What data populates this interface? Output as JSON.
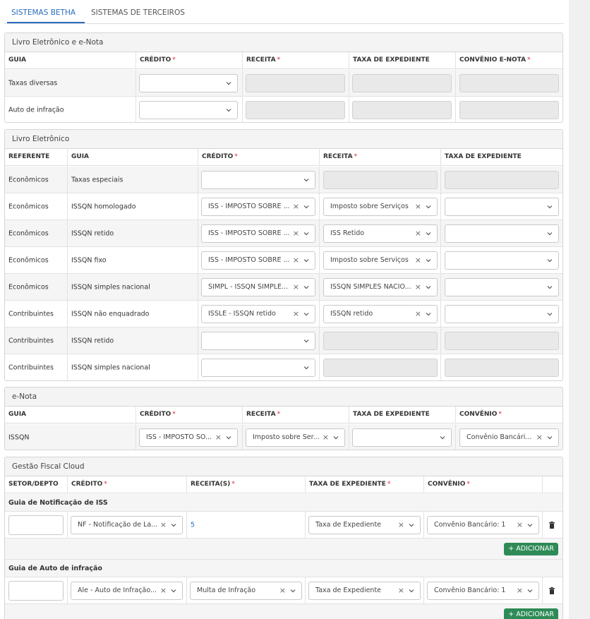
{
  "tabs": [
    {
      "label": "SISTEMAS BETHA",
      "active": true
    },
    {
      "label": "SISTEMAS DE TERCEIROS",
      "active": false
    }
  ],
  "colors": {
    "accent": "#2a6bbf",
    "required": "#dd2233",
    "add_button": "#2e8b57"
  },
  "icons": {
    "select": "chevron-down-icon",
    "clear": "close-icon",
    "delete": "trash-icon",
    "add": "plus-icon"
  },
  "required_mark": "*",
  "section1": {
    "title": "Livro Eletrônico e e-Nota",
    "headers": [
      "GUIA",
      "CRÉDITO",
      "RECEITA",
      "TAXA DE EXPEDIENTE",
      "CONVÊNIO E-NOTA"
    ],
    "rows": [
      {
        "guia": "Taxas diversas"
      },
      {
        "guia": "Auto de infração"
      }
    ]
  },
  "section2": {
    "title": "Livro Eletrônico",
    "headers": [
      "REFERENTE",
      "GUIA",
      "CRÉDITO",
      "RECEITA",
      "TAXA DE EXPEDIENTE"
    ],
    "rows": [
      {
        "referente": "Econômicos",
        "guia": "Taxas especiais",
        "credito": "",
        "receita": ""
      },
      {
        "referente": "Econômicos",
        "guia": "ISSQN homologado",
        "credito": "ISS - IMPOSTO SOBRE ...",
        "receita": "Imposto sobre Serviços"
      },
      {
        "referente": "Econômicos",
        "guia": "ISSQN retido",
        "credito": "ISS - IMPOSTO SOBRE ...",
        "receita": "ISS Retido"
      },
      {
        "referente": "Econômicos",
        "guia": "ISSQN fixo",
        "credito": "ISS - IMPOSTO SOBRE ...",
        "receita": "Imposto sobre Serviços"
      },
      {
        "referente": "Econômicos",
        "guia": "ISSQN simples nacional",
        "credito": "SIMPL - ISSQN SIMPLE...",
        "receita": "ISSQN SIMPLES NACIO..."
      },
      {
        "referente": "Contribuintes",
        "guia": "ISSQN não enquadrado",
        "credito": "ISSLE - ISSQN retido",
        "receita": "ISSQN retido"
      },
      {
        "referente": "Contribuintes",
        "guia": "ISSQN retido",
        "credito": "",
        "receita": ""
      },
      {
        "referente": "Contribuintes",
        "guia": "ISSQN simples nacional",
        "credito": "",
        "receita": ""
      }
    ]
  },
  "section3": {
    "title": "e-Nota",
    "headers": [
      "GUIA",
      "CRÉDITO",
      "RECEITA",
      "TAXA DE EXPEDIENTE",
      "CONVÊNIO"
    ],
    "row": {
      "guia": "ISSQN",
      "credito": "ISS - IMPOSTO SO...",
      "receita": "Imposto sobre Ser...",
      "convenio": "Convênio Bancári..."
    }
  },
  "section4": {
    "title": "Gestão Fiscal Cloud",
    "headers": [
      "SETOR/DEPTO",
      "CRÉDITO",
      "RECEITA(S)",
      "TAXA DE EXPEDIENTE",
      "CONVÊNIO"
    ],
    "groups": [
      {
        "title": "Guia de Notificação de ISS",
        "setor": "",
        "credito": "NF - Notificação de La...",
        "receitas": "5",
        "taxa": "Taxa de Expediente",
        "convenio": "Convênio Bancário: 1",
        "add_label": "ADICIONAR"
      },
      {
        "title": "Guia de Auto de infração",
        "setor": "",
        "credito": "Ale - Auto de Infração...",
        "receitas": "Multa de Infração",
        "taxa": "Taxa de Expediente",
        "convenio": "Convênio Bancário: 1",
        "add_label": "ADICIONAR"
      }
    ]
  }
}
